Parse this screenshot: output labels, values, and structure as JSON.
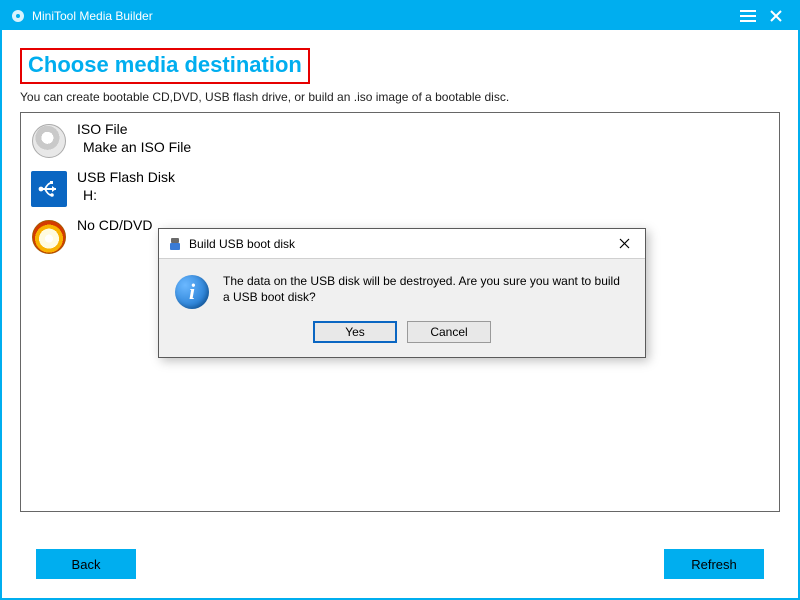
{
  "titlebar": {
    "app_name": "MiniTool Media Builder"
  },
  "page": {
    "heading": "Choose media destination",
    "subtext": "You can create bootable CD,DVD, USB flash drive, or build an .iso image of a bootable disc."
  },
  "destinations": {
    "iso": {
      "title": "ISO File",
      "sub": "Make an ISO File"
    },
    "usb": {
      "title": "USB Flash Disk",
      "sub": "H:"
    },
    "disc": {
      "title": "No CD/DVD"
    }
  },
  "buttons": {
    "back": "Back",
    "refresh": "Refresh"
  },
  "dialog": {
    "title": "Build USB boot disk",
    "message": "The data on the USB disk will be destroyed. Are you sure you want to build a USB boot disk?",
    "yes": "Yes",
    "cancel": "Cancel"
  }
}
